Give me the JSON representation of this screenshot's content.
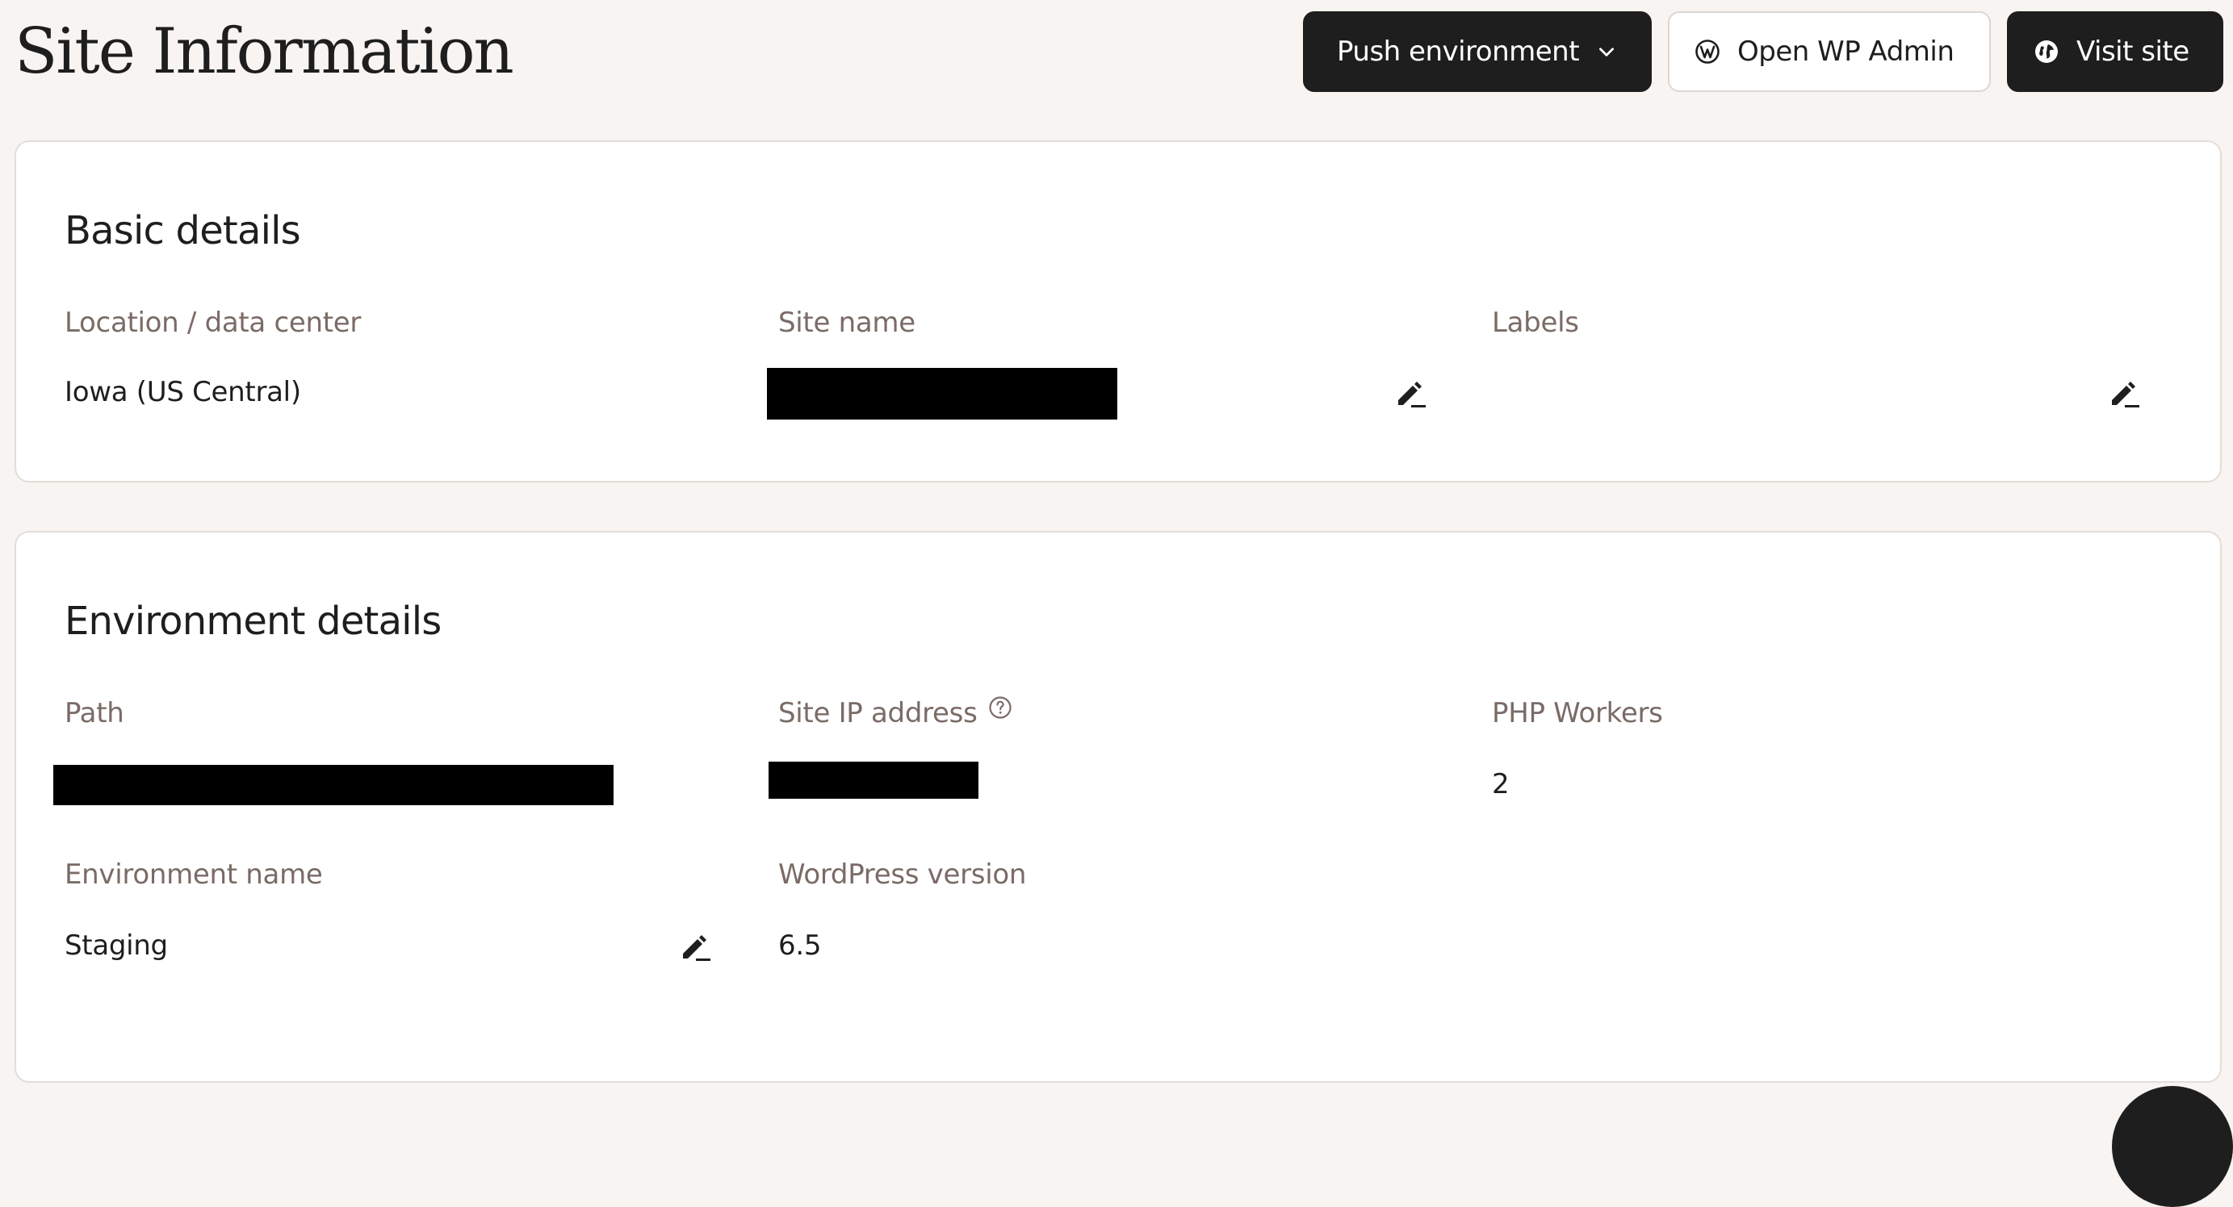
{
  "page": {
    "title": "Site Information"
  },
  "header_actions": {
    "push_label": "Push environment",
    "push_icon": "chevron-down-icon",
    "wp_admin_label": "Open WP Admin",
    "wp_admin_icon": "wordpress-icon",
    "visit_label": "Visit site",
    "visit_icon": "globe-icon"
  },
  "basic_details": {
    "title": "Basic details",
    "location_label": "Location / data center",
    "location_value": "Iowa (US Central)",
    "site_name_label": "Site name",
    "site_name_value": "[redacted]",
    "labels_label": "Labels",
    "labels_value": ""
  },
  "environment_details": {
    "title": "Environment details",
    "path_label": "Path",
    "path_value": "[redacted]",
    "ip_label": "Site IP address",
    "ip_value": "[redacted]",
    "php_workers_label": "PHP Workers",
    "php_workers_value": "2",
    "env_name_label": "Environment name",
    "env_name_value": "Staging",
    "wp_version_label": "WordPress version",
    "wp_version_value": "6.5"
  },
  "colors": {
    "background": "#f7f4f1",
    "card": "#ffffff",
    "primary_button": "#1e1e1e",
    "label_text": "#7a6b66",
    "border": "#e3ddd8"
  }
}
